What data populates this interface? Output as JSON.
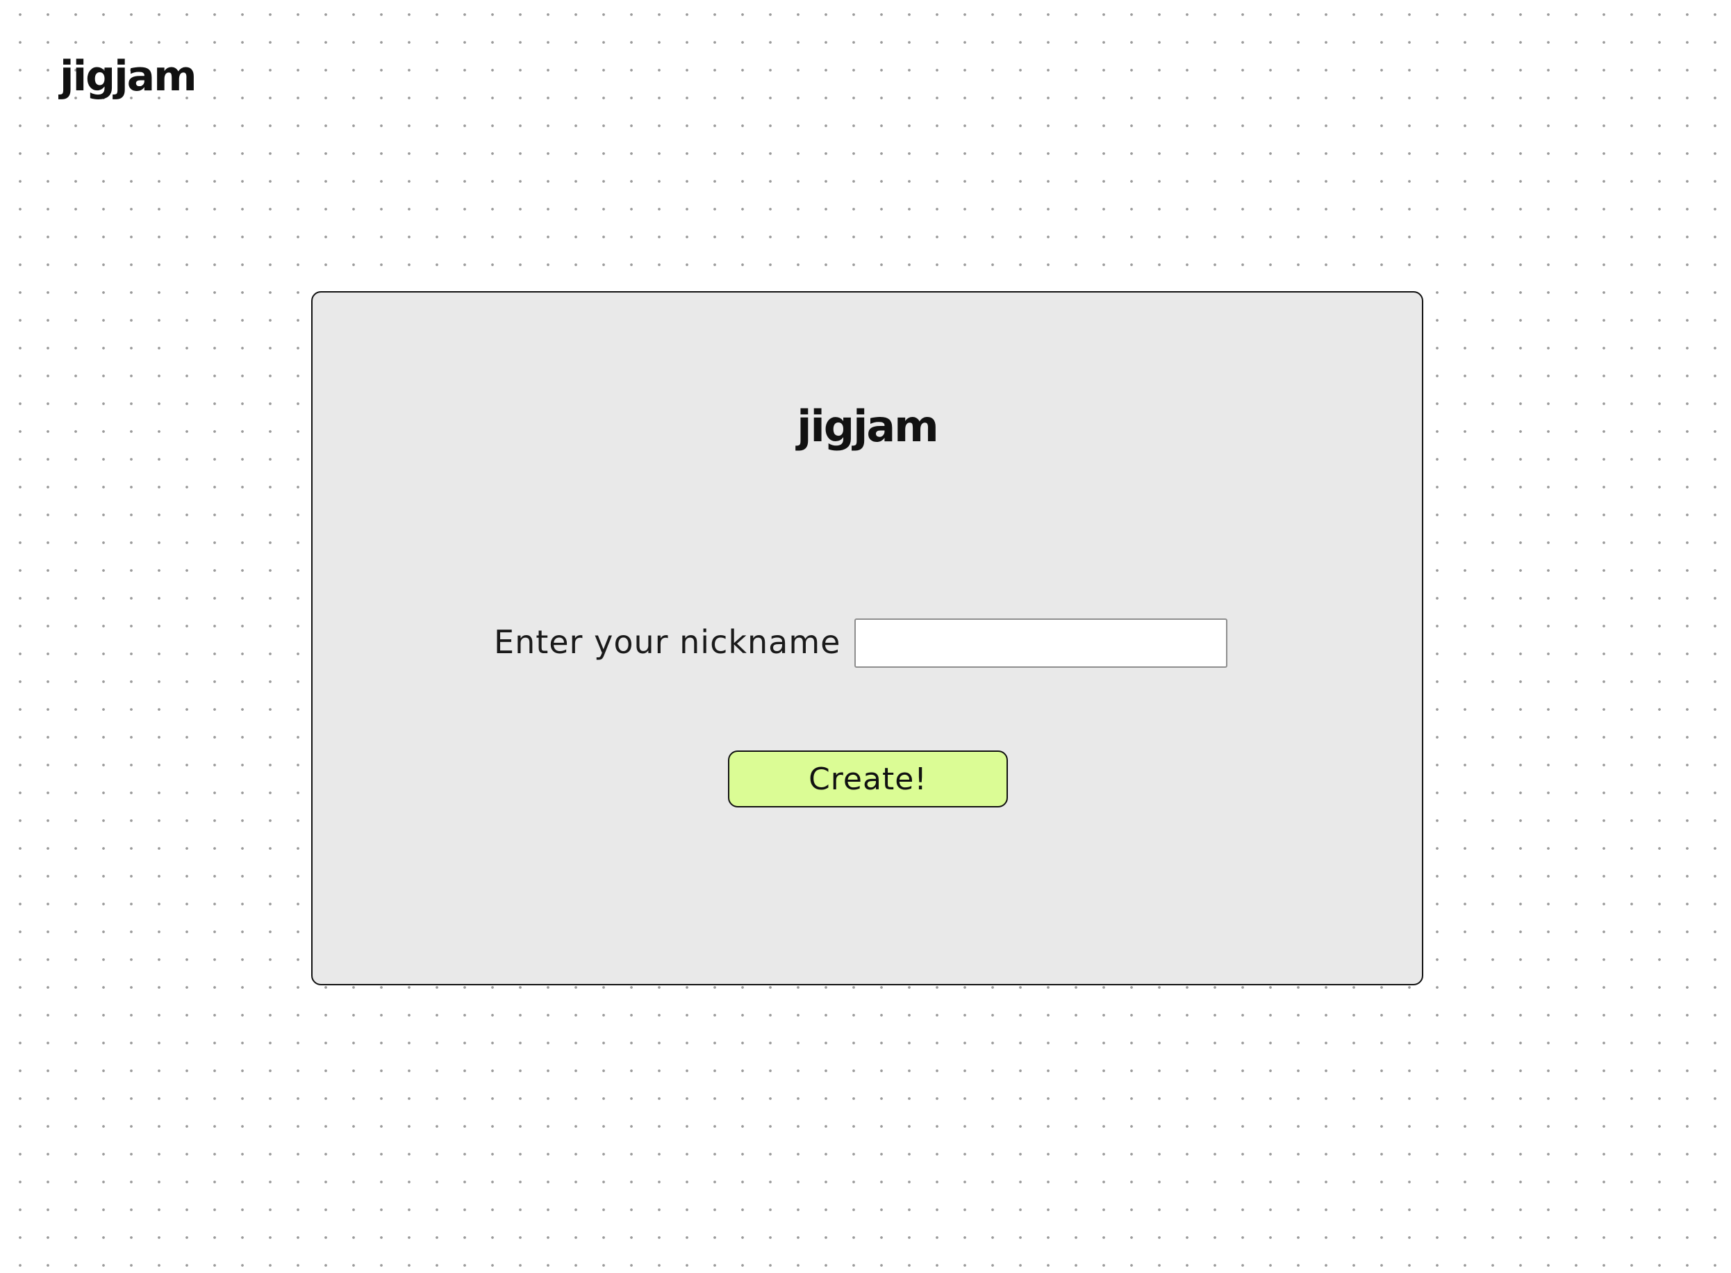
{
  "header": {
    "logo_text": "jigjam"
  },
  "card": {
    "logo_text": "jigjam",
    "nickname_label": "Enter your nickname",
    "nickname_value": "",
    "nickname_placeholder": "",
    "create_label": "Create!"
  },
  "colors": {
    "page_background": "#ffffff",
    "card_background": "#e9e9e9",
    "button_accent": "#dbfc95"
  }
}
